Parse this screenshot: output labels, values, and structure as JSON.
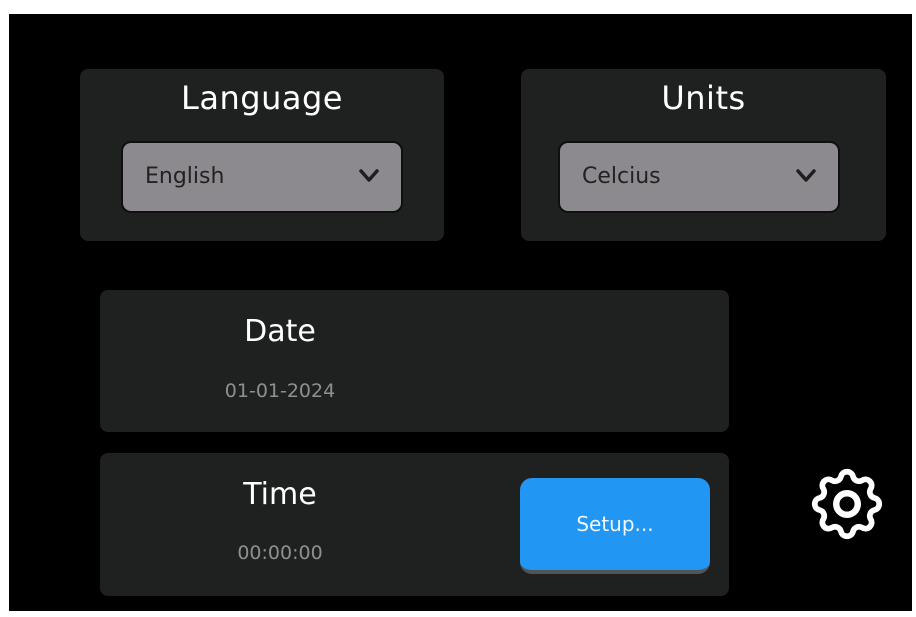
{
  "language": {
    "title": "Language",
    "selected": "English"
  },
  "units": {
    "title": "Units",
    "selected": "Celcius"
  },
  "date": {
    "label": "Date",
    "value": "01-01-2024"
  },
  "time": {
    "label": "Time",
    "value": "00:00:00",
    "setup_label": "Setup..."
  },
  "icons": {
    "dropdown_arrow": "chevron-down-icon",
    "settings": "gear-icon"
  },
  "colors": {
    "background": "#000000",
    "panel": "#1f2120",
    "dropdown": "#8c8a8e",
    "accent": "#2196f3"
  }
}
